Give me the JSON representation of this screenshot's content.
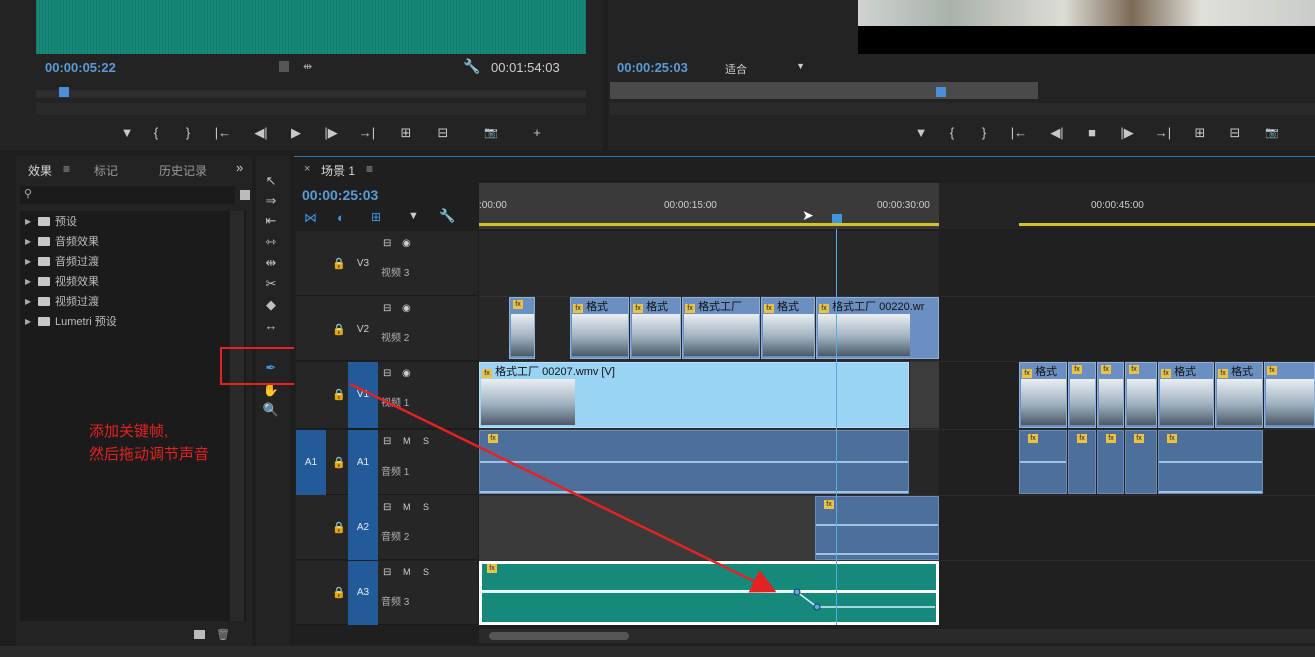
{
  "source_monitor": {
    "timecode": "00:00:05:22",
    "duration": "00:01:54:03",
    "controls": [
      "▼",
      "{",
      "}",
      "|←",
      "◀|",
      "▶",
      "|▶",
      "→|",
      "⊞",
      "⊟",
      "📷",
      "+"
    ]
  },
  "program_monitor": {
    "timecode": "00:00:25:03",
    "fit_label": "适合",
    "controls": [
      "▼",
      "{",
      "}",
      "|←",
      "◀|",
      "■",
      "|▶",
      "→|",
      "⊞",
      "⊟",
      "📷"
    ]
  },
  "effects_panel": {
    "tabs": [
      "效果",
      "标记",
      "历史记录"
    ],
    "tab_menu": "≡",
    "more": "»",
    "items": [
      "预设",
      "音频效果",
      "音频过渡",
      "视频效果",
      "视频过渡",
      "Lumetri 预设"
    ]
  },
  "sequence": {
    "tab_close": "×",
    "tab_name": "场景 1",
    "tab_menu": "≡",
    "timecode": "00:00:25:03",
    "ruler": [
      ":00:00",
      "00:00:15:00",
      "00:00:30:00",
      "00:00:45:00"
    ]
  },
  "tracks": {
    "v3": {
      "id": "V3",
      "name": "视频 3"
    },
    "v2": {
      "id": "V2",
      "name": "视频 2"
    },
    "v1": {
      "id": "V1",
      "name": "视频 1"
    },
    "a1": {
      "id": "A1",
      "name": "音频 1",
      "src": "A1"
    },
    "a2": {
      "id": "A2",
      "name": "音频 2"
    },
    "a3": {
      "id": "A3",
      "name": "音频 3"
    },
    "msl": [
      "M",
      "S"
    ]
  },
  "clips": {
    "v1_main": "格式工厂 00207.wmv [V]",
    "v2_labels": [
      "格式",
      "格式",
      "格式工厂",
      "格式",
      "格式工厂 00220.wr"
    ],
    "v1_right": [
      "格式",
      "格式",
      "格式"
    ]
  },
  "annotation": {
    "line1": "添加关键帧,",
    "line2": "然后拖动调节声音",
    "color": "#e52222"
  },
  "colors": {
    "accent": "#5b9bd5",
    "audio_teal": "#15897a",
    "clip_blue": "#9bd3f5"
  }
}
